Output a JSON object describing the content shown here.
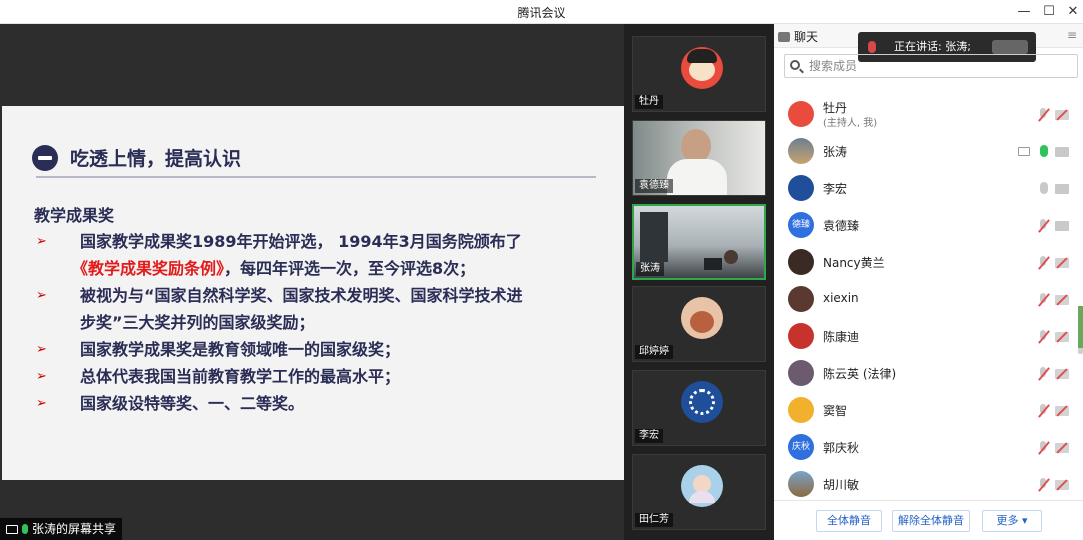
{
  "window": {
    "title": "腾讯会议",
    "min_icon": "minimize-icon",
    "max_icon": "maximize-icon",
    "close_icon": "close-icon"
  },
  "slide": {
    "heading": "吃透上情，提高认识",
    "subtitle": "教学成果奖",
    "bullets": [
      {
        "pre": "国家教学成果奖1989年开始评选， 1994年3月国务院颁布了",
        "highlight": "《教学成果奖励条例》",
        "post": "，每四年评选一次，至今评选8次；"
      },
      {
        "line1": "被视为与“国家自然科学奖、国家技术发明奖、国家科学技术进",
        "line2": "步奖”三大奖并列的国家级奖励；"
      },
      {
        "text": "国家教学成果奖是教育领域唯一的国家级奖；"
      },
      {
        "text": "总体代表我国当前教育教学工作的最高水平；"
      },
      {
        "text": "国家级设特等奖、一、二等奖。"
      }
    ],
    "arrow": "➢",
    "heading_color": "#2a2d55",
    "highlight_color": "#e21b1b"
  },
  "share_label": "张涛的屏幕共享",
  "video_tiles": [
    {
      "name": "牡丹"
    },
    {
      "name": "袁德臻"
    },
    {
      "name": "张涛"
    },
    {
      "name": "邱婷婷"
    },
    {
      "name": "李宏"
    },
    {
      "name": "田仁芳"
    }
  ],
  "panel": {
    "tab_label": "聊天",
    "menu_icon": "≡",
    "speaking_text": "正在讲话: 张涛;",
    "search_placeholder": "搜索成员",
    "members": [
      {
        "name": "牡丹",
        "role": "(主持人, 我)",
        "avatar": ""
      },
      {
        "name": "张涛",
        "role": "",
        "avatar": ""
      },
      {
        "name": "李宏",
        "role": "",
        "avatar": ""
      },
      {
        "name": "袁德臻",
        "role": "",
        "avatar": "德臻"
      },
      {
        "name": "Nancy黄兰",
        "role": "",
        "avatar": ""
      },
      {
        "name": "xiexin",
        "role": "",
        "avatar": ""
      },
      {
        "name": "陈康迪",
        "role": "",
        "avatar": ""
      },
      {
        "name": "陈云英 (法律)",
        "role": "",
        "avatar": ""
      },
      {
        "name": "窦智",
        "role": "",
        "avatar": ""
      },
      {
        "name": "郭庆秋",
        "role": "",
        "avatar": "庆秋"
      },
      {
        "name": "胡川敏",
        "role": "",
        "avatar": ""
      }
    ],
    "buttons": {
      "mute_all": "全体静音",
      "unmute_all": "解除全体静音",
      "more": "更多 ▾"
    }
  }
}
